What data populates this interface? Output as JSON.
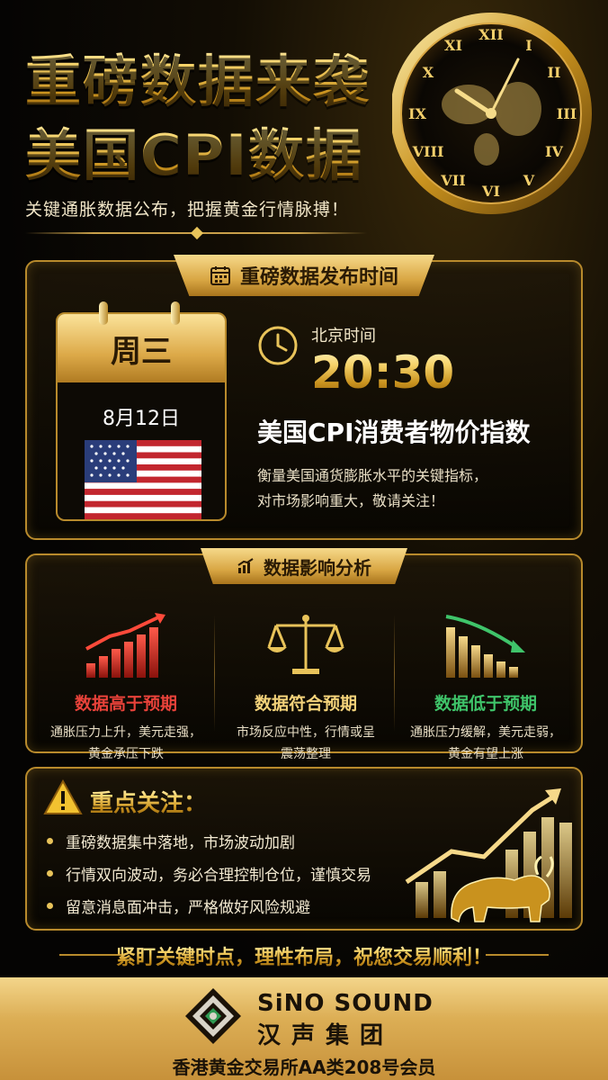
{
  "header": {
    "title_line1": "重磅数据来袭",
    "title_line2": "美国CPI数据",
    "subtitle": "关键通胀数据公布，把握黄金行情脉搏！"
  },
  "release": {
    "section_title": "重磅数据发布时间",
    "calendar_icon": "calendar-icon",
    "weekday": "周三",
    "date": "8月12日",
    "flag": "us-flag",
    "time_label": "北京时间",
    "time": "20:30",
    "indicator_name": "美国CPI消费者物价指数",
    "description_line1": "衡量美国通货膨胀水平的关键指标，",
    "description_line2": "对市场影响重大，敬请关注！"
  },
  "analysis": {
    "section_title": "数据影响分析",
    "chart_icon": "bar-chart-icon",
    "scenarios": [
      {
        "icon": "rising-bars-icon",
        "title": "数据高于预期",
        "line1": "通胀压力上升，美元走强，",
        "line2": "黄金承压下跌",
        "color": "#e8423a"
      },
      {
        "icon": "balance-scale-icon",
        "title": "数据符合预期",
        "line1": "市场反应中性，行情或呈",
        "line2": "震荡整理",
        "color": "#f3d27a"
      },
      {
        "icon": "falling-bars-icon",
        "title": "数据低于预期",
        "line1": "通胀压力缓解，美元走弱，",
        "line2": "黄金有望上涨",
        "color": "#3fc46a"
      }
    ]
  },
  "focus": {
    "title": "重点关注：",
    "warning_icon": "warning-icon",
    "items": [
      "重磅数据集中落地，市场波动加剧",
      "行情双向波动，务必合理控制仓位，谨慎交易",
      "留意消息面冲击，严格做好风险规避"
    ]
  },
  "cta": "紧盯关键时点，理性布局，祝您交易顺利！",
  "footer": {
    "brand_en": "SiNO SOUND",
    "brand_cn": "汉声集团",
    "membership": "香港黄金交易所AA类208号会员"
  },
  "colors": {
    "gold": "#d9a744",
    "accent_red": "#e8423a",
    "accent_green": "#3fc46a"
  }
}
